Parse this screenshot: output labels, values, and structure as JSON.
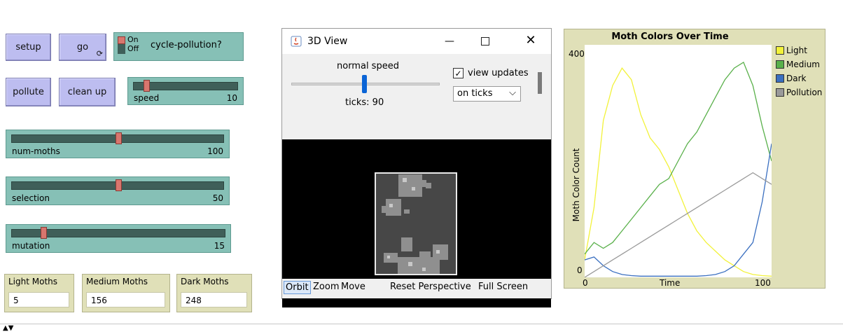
{
  "buttons": {
    "setup": "setup",
    "go": "go",
    "pollute": "pollute",
    "clean_up": "clean up"
  },
  "switch": {
    "on": "On",
    "off": "Off",
    "label": "cycle-pollution?",
    "state": "on"
  },
  "sliders": {
    "speed": {
      "label": "speed",
      "value": "10",
      "fraction": 0.1
    },
    "num_moths": {
      "label": "num-moths",
      "value": "100",
      "fraction": 0.5
    },
    "selection": {
      "label": "selection",
      "value": "50",
      "fraction": 0.5
    },
    "mutation": {
      "label": "mutation",
      "value": "15",
      "fraction": 0.15
    }
  },
  "monitors": {
    "light": {
      "label": "Light Moths",
      "value": "5"
    },
    "medium": {
      "label": "Medium Moths",
      "value": "156"
    },
    "dark": {
      "label": "Dark Moths",
      "value": "248"
    }
  },
  "view_window": {
    "title": "3D View",
    "speed_label": "normal speed",
    "ticks": "ticks: 90",
    "view_updates_label": "view updates",
    "view_updates_checked": true,
    "update_mode": "on ticks",
    "bottom_buttons": [
      "Orbit",
      "Zoom",
      "Move",
      "Reset Perspective",
      "Full Screen"
    ]
  },
  "colors": {
    "button_bg": "#bdbdf0",
    "slider_bg": "#86c0b6",
    "monitor_bg": "#e0e0b8",
    "light": "#f2f23a",
    "medium": "#59b04a",
    "dark": "#3a6fc0",
    "pollution": "#9a9a9a"
  },
  "chart_data": {
    "type": "line",
    "title": "Moth Colors Over Time",
    "xlabel": "Time",
    "ylabel": "Moth Color Count",
    "xlim": [
      0,
      100
    ],
    "ylim": [
      0,
      400
    ],
    "x_ticks": [
      "0",
      "100"
    ],
    "y_ticks": [
      "0",
      "400"
    ],
    "legend_position": "right",
    "x": [
      0,
      5,
      10,
      15,
      20,
      25,
      30,
      35,
      40,
      45,
      50,
      55,
      60,
      65,
      70,
      75,
      80,
      85,
      90,
      95,
      100
    ],
    "series": [
      {
        "name": "Light",
        "color": "#f2f23a",
        "values": [
          30,
          120,
          270,
          330,
          360,
          340,
          280,
          240,
          220,
          190,
          150,
          110,
          80,
          60,
          45,
          30,
          20,
          10,
          5,
          3,
          2
        ]
      },
      {
        "name": "Medium",
        "color": "#59b04a",
        "values": [
          40,
          60,
          50,
          60,
          80,
          100,
          120,
          140,
          160,
          170,
          200,
          230,
          250,
          280,
          310,
          340,
          360,
          370,
          330,
          260,
          200
        ]
      },
      {
        "name": "Dark",
        "color": "#3a6fc0",
        "values": [
          30,
          35,
          20,
          10,
          5,
          3,
          2,
          2,
          2,
          2,
          2,
          2,
          2,
          3,
          5,
          10,
          20,
          40,
          60,
          130,
          230
        ]
      },
      {
        "name": "Pollution",
        "color": "#9a9a9a",
        "values": [
          0,
          10,
          20,
          30,
          40,
          50,
          60,
          70,
          80,
          90,
          100,
          110,
          120,
          130,
          140,
          150,
          160,
          170,
          180,
          170,
          160
        ]
      }
    ]
  }
}
